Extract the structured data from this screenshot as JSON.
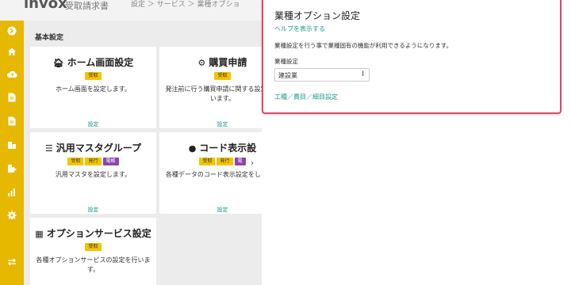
{
  "header": {
    "logo": "invox",
    "product": "受取請求書",
    "breadcrumb": "設定 ＞ サービス ＞ 業種オプショ"
  },
  "sidebar": {
    "icons": [
      "arrow-right-circle-icon",
      "home-icon",
      "cloud-upload-icon",
      "document-icon",
      "document-icon",
      "building-icon",
      "export-icon",
      "chart-icon",
      "gear-icon",
      "swap-icon"
    ]
  },
  "main": {
    "section_title": "基本設定",
    "cards": [
      {
        "title": "ホーム画面設定",
        "badges": [
          {
            "label": "受取",
            "color": "#f5c400"
          }
        ],
        "desc": "ホーム画面を設定します。",
        "link": "設定"
      },
      {
        "title": "購買申請",
        "badges": [
          {
            "label": "受取",
            "color": "#f5c400"
          }
        ],
        "desc": "発注前に行う購買申請に関する設定を行います。",
        "link": "設定"
      },
      {
        "title": "汎用マスタグループ",
        "badges": [
          {
            "label": "受取",
            "color": "#f5c400"
          },
          {
            "label": "発行",
            "color": "#f5c400"
          },
          {
            "label": "電帳",
            "color": "#8e44ad"
          }
        ],
        "desc": "汎用マスタを設定します。",
        "link": "設定"
      },
      {
        "title": "コード表示設",
        "badges": [
          {
            "label": "受取",
            "color": "#f5c400"
          },
          {
            "label": "発行",
            "color": "#f5c400"
          },
          {
            "label": "電",
            "color": "#8e44ad"
          }
        ],
        "desc": "各種データのコード表示設定をします。",
        "link": "設定"
      },
      {
        "title": "オプションサービス設定",
        "badges": [
          {
            "label": "受取",
            "color": "#f5c400"
          }
        ],
        "desc": "各種オプションサービスの設定を行います。",
        "link": ""
      }
    ]
  },
  "panel": {
    "title": "業種オプション設定",
    "help_link": "ヘルプを表示する",
    "description": "業種設定を行う事で業種固有の機能が利用できるようになります。",
    "field_label": "業種設定",
    "field_value": "建設業",
    "sub_link": "工種／費目／細目設定"
  }
}
